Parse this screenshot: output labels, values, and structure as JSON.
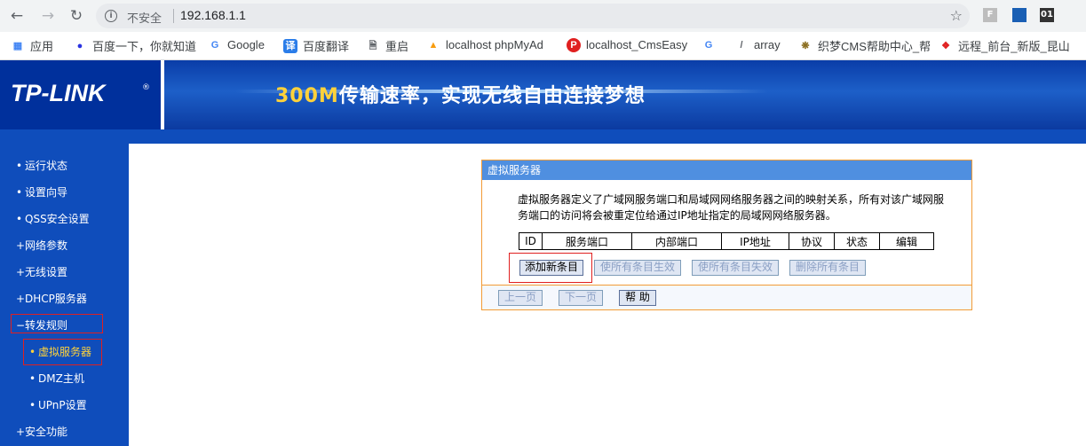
{
  "browser": {
    "not_secure": "不安全",
    "url": "192.168.1.1",
    "icons": {
      "back": "back-arrow-icon",
      "forward": "forward-arrow-icon",
      "reload": "reload-icon",
      "info": "info-icon",
      "star": "star-icon"
    },
    "extensions": [
      "F",
      "",
      "01"
    ]
  },
  "bookmarks": [
    {
      "label": "应用",
      "icon": "apps-grid-icon"
    },
    {
      "label": "百度一下，你就知道",
      "icon": "baidu-paw-icon"
    },
    {
      "label": "Google",
      "icon": "google-g-icon"
    },
    {
      "label": "百度翻译",
      "icon": "translate-icon"
    },
    {
      "label": "重启",
      "icon": "page-icon"
    },
    {
      "label": "localhost phpMyAd",
      "icon": "phpmyadmin-icon"
    },
    {
      "label": "localhost_CmsEasy",
      "icon": "p-circle-icon"
    },
    {
      "label": "",
      "icon": "google-g-icon"
    },
    {
      "label": "array",
      "icon": "slash-icon"
    },
    {
      "label": "织梦CMS帮助中心_帮",
      "icon": "dedecms-icon"
    },
    {
      "label": "远程_前台_新版_昆山",
      "icon": "diamond-icon"
    }
  ],
  "header": {
    "logo": "TP-LINK",
    "slogan_highlight": "300M",
    "slogan_rest": "传输速率，实现无线自由连接梦想"
  },
  "sidebar": {
    "items": [
      {
        "label": "运行状态",
        "marker": "•"
      },
      {
        "label": "设置向导",
        "marker": "•"
      },
      {
        "label": "QSS安全设置",
        "marker": "•"
      },
      {
        "label": "网络参数",
        "marker": "+"
      },
      {
        "label": "无线设置",
        "marker": "+"
      },
      {
        "label": "DHCP服务器",
        "marker": "+"
      },
      {
        "label": "转发规则",
        "marker": "−"
      }
    ],
    "sub_items": [
      {
        "label": "虚拟服务器",
        "marker": "•"
      },
      {
        "label": "DMZ主机",
        "marker": "•"
      },
      {
        "label": "UPnP设置",
        "marker": "•"
      }
    ],
    "last_item": {
      "label": "安全功能",
      "marker": "+"
    }
  },
  "panel": {
    "title": "虚拟服务器",
    "description": "虚拟服务器定义了广域网服务端口和局域网网络服务器之间的映射关系，所有对该广域网服务端口的访问将会被重定位给通过IP地址指定的局域网网络服务器。",
    "table_headers": [
      "ID",
      "服务端口",
      "内部端口",
      "IP地址",
      "协议",
      "状态",
      "编辑"
    ],
    "buttons": {
      "add_new": "添加新条目",
      "enable_all": "使所有条目生效",
      "disable_all": "使所有条目失效",
      "delete_all": "删除所有条目"
    },
    "footer": {
      "prev": "上一页",
      "next": "下一页",
      "help": "帮 助"
    }
  },
  "colors": {
    "tp_blue": "#0f4dbb",
    "panel_title": "#4f8fe0",
    "panel_border": "#f29b36",
    "highlight_box": "#e02020"
  }
}
